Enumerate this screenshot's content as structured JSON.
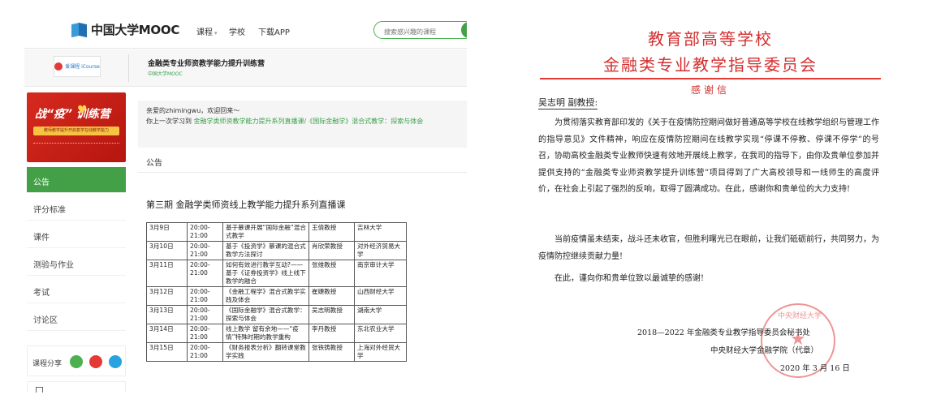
{
  "mooc": {
    "logo_text": "中国大学MOOC",
    "nav": {
      "course": "课程",
      "course_arrow": "▾",
      "school": "学校",
      "app": "下载APP"
    },
    "search_placeholder": "搜索感兴趣的课程",
    "icourse_text": "爱课程 iCourse",
    "course_title": "金融类专业师资教学能力提升训练营",
    "course_sub": "中国大学MOOC",
    "banner": {
      "title": "战“疫”  训练营",
      "strip": "教师教学提升开启复学在线教学能力"
    },
    "sidebar_items": [
      "公告",
      "评分标准",
      "课件",
      "测验与作业",
      "考试",
      "讨论区"
    ],
    "share_label": "课程分享",
    "welcome": {
      "line1": "亲爱的zhimingwu，欢迎回来～",
      "line2_prefix": "你上一次学习到",
      "line2_link": "金融学类师资教学能力提升系列直播课/《国际金融学》混合式教学：探索与体会"
    },
    "announce_label": "公告",
    "announce_title": "第三期 金融学类师资线上教学能力提升系列直播课",
    "schedule": [
      [
        "3月9日",
        "20:00-21:00",
        "基于慕课开展“国际金融”混合式教学",
        "王倩教授",
        "吉林大学"
      ],
      [
        "3月10日",
        "20:00-21:00",
        "基于《投资学》慕课的混合式教学方法探讨",
        "肖欣荣教授",
        "对外经济贸易大学"
      ],
      [
        "3月11日",
        "20:00-21:00",
        "如何有效进行教学互动?——基于《证券投资学》线上线下教学的融合",
        "张维教授",
        "南京审计大学"
      ],
      [
        "3月12日",
        "20:00-21:00",
        "《金融工程学》混合式教学实践及体会",
        "崔婕教授",
        "山西财经大学"
      ],
      [
        "3月13日",
        "20:00-21:00",
        "《国际金融学》混合式教学：探索与体会",
        "吴志明教授",
        "湖南大学"
      ],
      [
        "3月14日",
        "20:00-21:00",
        "线上教学   留有余地——“疫情”特殊时期的教学重构",
        "李丹教授",
        "东北农业大学"
      ],
      [
        "3月15日",
        "20:00-21:00",
        "《财务报表分析》翻转课堂教学实践",
        "张铁铸教授",
        "上海对外经贸大学"
      ]
    ]
  },
  "letter": {
    "org_line1": "教育部高等学校",
    "org_line2": "金融类专业教学指导委员会",
    "title": "感谢信",
    "salutation": "吴志明  副教授:",
    "para1": "为贯彻落实教育部印发的《关于在疫情防控期间做好普通高等学校在线教学组织与管理工作的指导意见》文件精神，响应在疫情防控期间在线教学实现“停课不停教、停课不停学”的号召，协助高校金融类专业教师快速有效地开展线上教学，在我司的指导下，由你及贵单位参加并提供支持的“金融类专业师资教学提升训练营”项目得到了广大高校领导和一线师生的高度评价，在社会上引起了强烈的反响，取得了圆满成功。在此，感谢你和贵单位的大力支持!",
    "para2": "当前疫情虽未结束，战斗还未收官，但胜利曙光已在眼前，让我们砥砺前行，共同努力，为疫情防控继续贡献力量!",
    "para3": "在此，谨向你和贵单位致以最诚挚的感谢!",
    "sign1": "2018—2022 年金融类专业教学指导委员会秘书处",
    "sign2": "中央财经大学金融学院（代章）",
    "sign3": "2020 年 3 月 16 日",
    "seal_text": "中央财经大学"
  },
  "colors": {
    "accent_green": "#43a047",
    "letter_red": "#d32f2f"
  }
}
